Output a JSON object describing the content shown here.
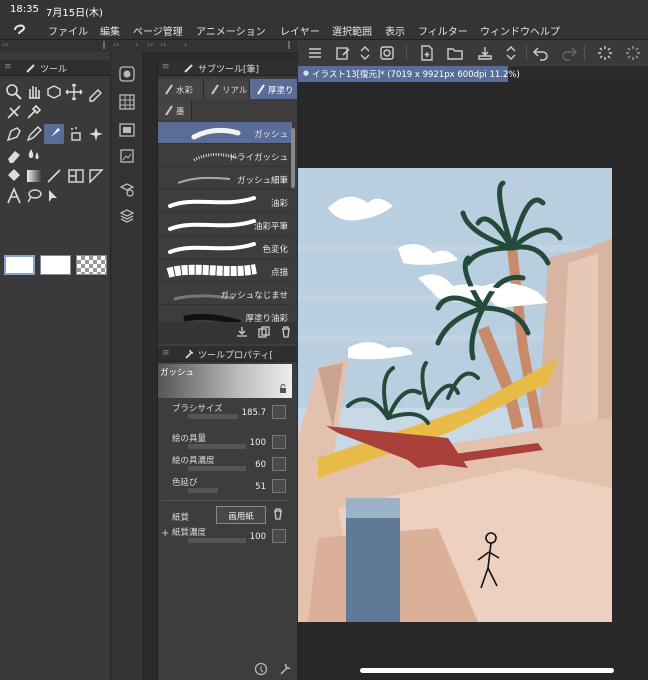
{
  "status": {
    "time": "18:35",
    "date": "7月15日(木)"
  },
  "menu": [
    "ファイル",
    "編集",
    "ページ管理",
    "アニメーション",
    "レイヤー",
    "選択範囲",
    "表示",
    "フィルター",
    "ウィンドウ",
    "ヘルプ"
  ],
  "tool_panel": {
    "title": "ツール"
  },
  "sub_tool_panel": {
    "title": "サブツール[筆]",
    "tabs": [
      "水彩",
      "リアル",
      "厚塗り",
      "墨"
    ],
    "brushes": [
      "ガッシュ",
      "ドライガッシュ",
      "ガッシュ細筆",
      "油彩",
      "油彩平筆",
      "色変化",
      "点描",
      "ガッシュなじませ",
      "厚塗り油彩"
    ]
  },
  "tool_property": {
    "title": "ツールプロパティ[",
    "brush_name": "ガッシュ",
    "brush_size_label": "ブラシサイズ",
    "brush_size": "185.7",
    "paint_amount_label": "絵の具量",
    "paint_amount": "100",
    "paint_density_label": "絵の具濃度",
    "paint_density": "60",
    "color_stretch_label": "色延び",
    "color_stretch": "51",
    "paper_label": "紙質",
    "paper_value": "画用紙",
    "paper_density_label": "紙質濃度",
    "paper_density": "100"
  },
  "canvas": {
    "tab_title": "イラスト13[復元]* (7019 x 9921px 600dpi 11.2%)"
  },
  "colors": {
    "accent": "#5a6d99",
    "panel": "#3a3a3a",
    "background": "#282828"
  }
}
